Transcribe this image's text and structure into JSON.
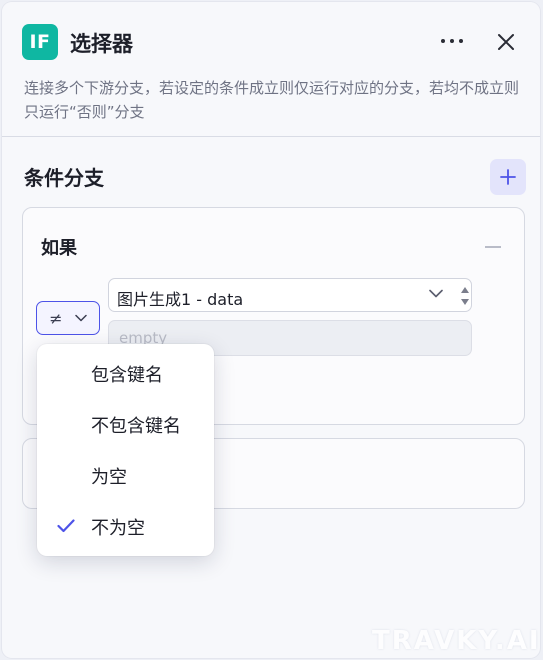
{
  "header": {
    "icon_text": "IF",
    "title": "选择器",
    "description": "连接多个下游分支，若设定的条件成立则仅运行对应的分支，若均不成立则只运行“否则”分支"
  },
  "section": {
    "title": "条件分支"
  },
  "branch": {
    "title": "如果",
    "operator_glyph": "≠",
    "variable_label": "图片生成1 - data",
    "value_placeholder": "empty"
  },
  "dropdown": {
    "options": [
      {
        "label": "包含键名",
        "selected": false
      },
      {
        "label": "不包含键名",
        "selected": false
      },
      {
        "label": "为空",
        "selected": false
      },
      {
        "label": "不为空",
        "selected": true
      }
    ]
  },
  "watermark": "TRAVKY.AI",
  "colors": {
    "accent": "#4d53e8",
    "brand_icon": "#0fb7a2"
  },
  "icons": {
    "more": "more-horizontal-icon",
    "close": "close-icon",
    "add": "plus-icon",
    "collapse": "minus-icon",
    "chevron": "chevron-down-icon",
    "check": "check-icon"
  }
}
